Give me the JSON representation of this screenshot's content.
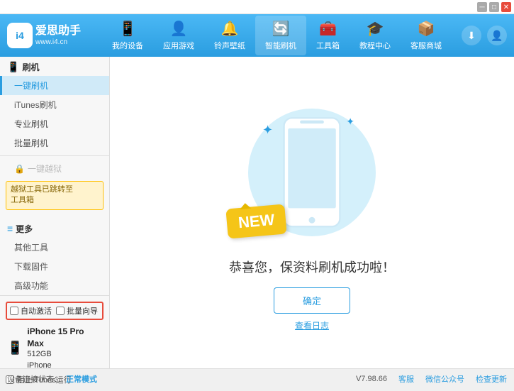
{
  "app": {
    "title": "爱思助手",
    "subtitle": "www.i4.cn",
    "logo_text": "i4"
  },
  "topstrip": {
    "win_min": "─",
    "win_max": "□",
    "win_close": "✕"
  },
  "nav": {
    "items": [
      {
        "id": "my-device",
        "label": "我的设备",
        "icon": "📱"
      },
      {
        "id": "apps-games",
        "label": "应用游戏",
        "icon": "👤"
      },
      {
        "id": "ringtone",
        "label": "铃声壁纸",
        "icon": "🔔"
      },
      {
        "id": "smart-flash",
        "label": "智能刷机",
        "icon": "🔄"
      },
      {
        "id": "toolbox",
        "label": "工具箱",
        "icon": "🧰"
      },
      {
        "id": "tutorial",
        "label": "教程中心",
        "icon": "🎓"
      },
      {
        "id": "service",
        "label": "客服商城",
        "icon": "📦"
      }
    ],
    "download_icon": "⬇",
    "user_icon": "👤"
  },
  "sidebar": {
    "flash_section": {
      "header": "刷机",
      "icon": "📱"
    },
    "items": [
      {
        "id": "one-key-flash",
        "label": "一键刷机",
        "active": true
      },
      {
        "id": "itunes-flash",
        "label": "iTunes刷机",
        "active": false
      },
      {
        "id": "pro-flash",
        "label": "专业刷机",
        "active": false
      },
      {
        "id": "batch-flash",
        "label": "批量刷机",
        "active": false
      }
    ],
    "disabled_item": {
      "label": "一键越狱",
      "icon": "🔒"
    },
    "notice": {
      "text": "越狱工具已跳转至\n工具箱"
    },
    "more_section": {
      "header": "更多",
      "icon": "≡"
    },
    "more_items": [
      {
        "id": "other-tools",
        "label": "其他工具"
      },
      {
        "id": "download-firmware",
        "label": "下载固件"
      },
      {
        "id": "advanced",
        "label": "高级功能"
      }
    ],
    "bottom": {
      "auto_activate": "自动激活",
      "batch_guide": "批量向导",
      "device_icon": "📱",
      "device_name": "iPhone 15 Pro Max",
      "device_storage": "512GB",
      "device_type": "iPhone",
      "itunes_label": "阻止iTunes运行"
    }
  },
  "content": {
    "badge_text": "NEW",
    "success_text": "恭喜您，保资料刷机成功啦！",
    "confirm_button": "确定",
    "log_link": "查看日志"
  },
  "statusbar": {
    "label_mode": "设备连接状态：",
    "mode": "正常模式",
    "version": "V7.98.66",
    "links": [
      "客服",
      "微信公众号",
      "检查更新"
    ]
  }
}
